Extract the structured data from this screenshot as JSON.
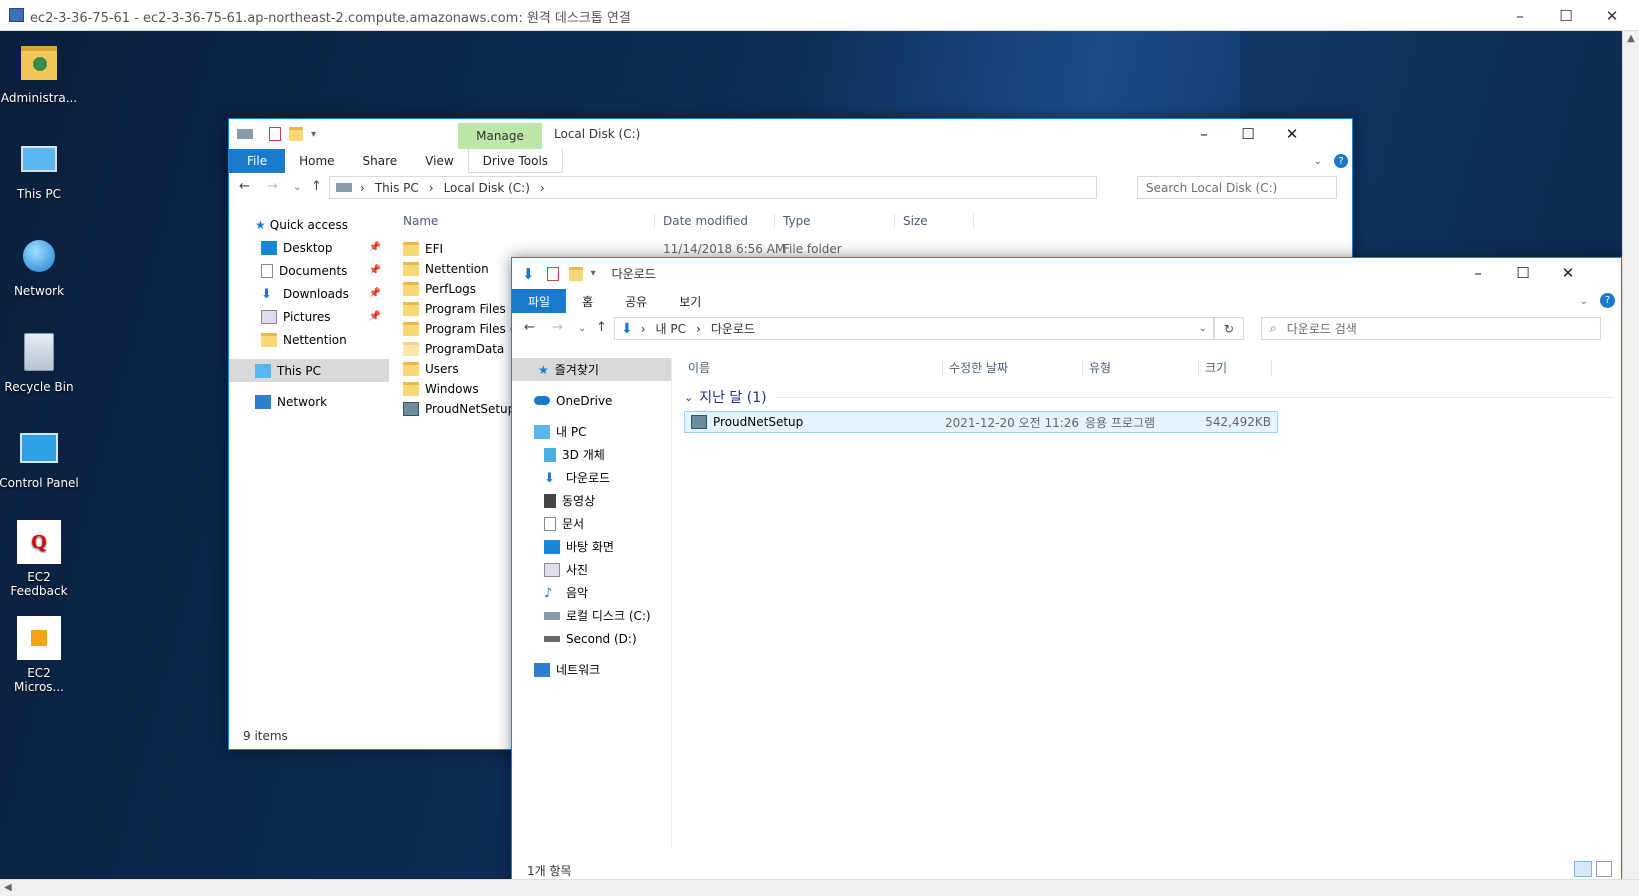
{
  "rdp": {
    "title": "ec2-3-36-75-61 - ec2-3-36-75-61.ap-northeast-2.compute.amazonaws.com: 원격 데스크톱 연결"
  },
  "desktop_icons": [
    {
      "label": "Administra..."
    },
    {
      "label": "This PC"
    },
    {
      "label": "Network"
    },
    {
      "label": "Recycle Bin"
    },
    {
      "label": "Control Panel"
    },
    {
      "label": "EC2 Feedback"
    },
    {
      "label": "EC2 Micros..."
    }
  ],
  "win1": {
    "title": "Local Disk (C:)",
    "context_tab": "Manage",
    "tabs": [
      "File",
      "Home",
      "Share",
      "View",
      "Drive Tools"
    ],
    "breadcrumb": [
      "This PC",
      "Local Disk (C:)"
    ],
    "search_placeholder": "Search Local Disk (C:)",
    "nav": [
      "Quick access",
      "Desktop",
      "Documents",
      "Downloads",
      "Pictures",
      "Nettention",
      "This PC",
      "Network"
    ],
    "columns": [
      "Name",
      "Date modified",
      "Type",
      "Size"
    ],
    "files": [
      {
        "name": "EFI",
        "date": "11/14/2018 6:56 AM",
        "type": "File folder"
      },
      {
        "name": "Nettention"
      },
      {
        "name": "PerfLogs"
      },
      {
        "name": "Program Files"
      },
      {
        "name": "Program Files (x"
      },
      {
        "name": "ProgramData"
      },
      {
        "name": "Users"
      },
      {
        "name": "Windows"
      },
      {
        "name": "ProudNetSetup"
      }
    ],
    "status": "9 items"
  },
  "win2": {
    "title": "다운로드",
    "tabs": [
      "파일",
      "홈",
      "공유",
      "보기"
    ],
    "breadcrumb": [
      "내 PC",
      "다운로드"
    ],
    "search_placeholder": "다운로드 검색",
    "nav": [
      "즐겨찾기",
      "OneDrive",
      "내 PC",
      "3D 개체",
      "다운로드",
      "동영상",
      "문서",
      "바탕 화면",
      "사진",
      "음악",
      "로컬 디스크 (C:)",
      "Second (D:)",
      "네트워크"
    ],
    "columns": [
      "이름",
      "수정한 날짜",
      "유형",
      "크기"
    ],
    "group": "지난 달 (1)",
    "file": {
      "name": "ProudNetSetup",
      "date": "2021-12-20 오전 11:26",
      "type": "응용 프로그램",
      "size": "542,492KB"
    },
    "status": "1개 항목"
  }
}
